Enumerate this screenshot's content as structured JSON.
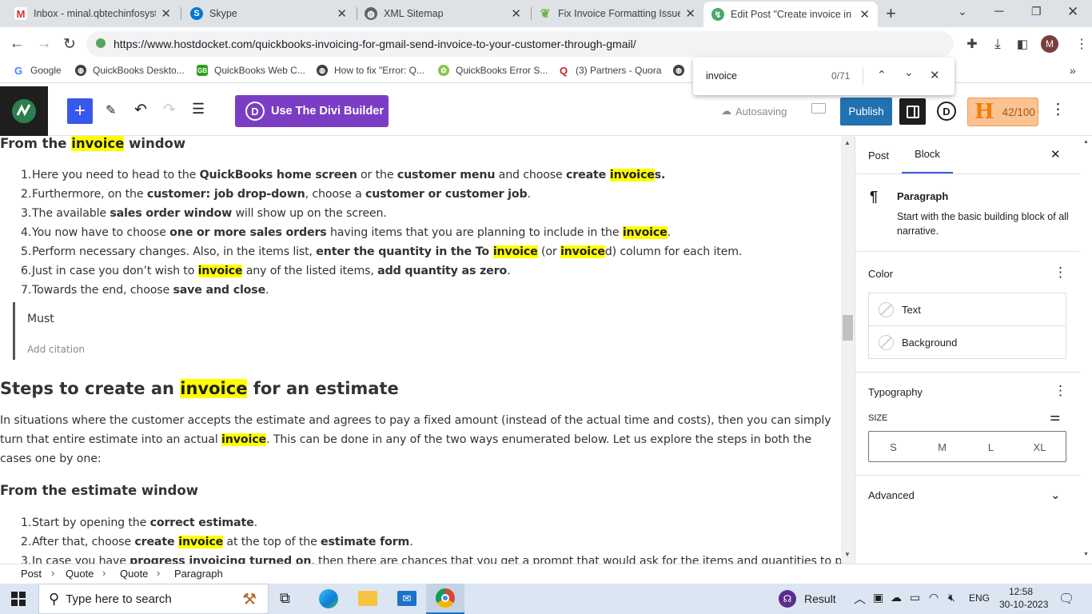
{
  "browser": {
    "tabs": [
      {
        "title": "Inbox - minal.qbtechinfosyst",
        "icon": "gmail-icon"
      },
      {
        "title": "Skype",
        "icon": "skype-icon"
      },
      {
        "title": "XML Sitemap",
        "icon": "globe-icon"
      },
      {
        "title": "Fix Invoice Formatting Issue",
        "icon": "leaf-icon"
      },
      {
        "title": "Edit Post \"Create invoice in Q",
        "icon": "wp-site-icon"
      }
    ],
    "url": "https://www.hostdocket.com/quickbooks-invoicing-for-gmail-send-invoice-to-your-customer-through-gmail/",
    "profile_initial": "M",
    "bookmarks": [
      "Google",
      "QuickBooks Deskto...",
      "QuickBooks Web C...",
      "How to fix \"Error: Q...",
      "QuickBooks Error S...",
      "(3) Partners - Quora"
    ],
    "find": {
      "query": "invoice",
      "count": "0/71"
    }
  },
  "wp_toolbar": {
    "divi_label": "Use The Divi Builder",
    "autosave": "Autosaving",
    "publish": "Publish",
    "divi_icon_letter": "D",
    "seo_letter": "H",
    "seo_score": "42/100"
  },
  "content": {
    "h_invoice_window": [
      "From the ",
      "invoice",
      " window"
    ],
    "list1": [
      [
        "Here you need to head to the ",
        "QuickBooks home screen",
        " or the ",
        "customer menu",
        " and choose ",
        "create ",
        "invoice",
        "s."
      ],
      [
        "Furthermore, on the ",
        "customer: job drop-down",
        ", choose a ",
        "customer or customer job",
        "."
      ],
      [
        "The available ",
        "sales order window",
        " will show up on the screen."
      ],
      [
        "You now have to choose ",
        "one or more sales orders",
        " having items that you are planning to include in the ",
        "invoice",
        "."
      ],
      [
        "Perform necessary changes. Also, in the items list, ",
        "enter the quantity in the To ",
        "invoice",
        " (or ",
        "invoice",
        "d) column for each item."
      ],
      [
        "Just in case you don’t wish to ",
        "invoice",
        " any of the listed items, ",
        "add quantity as zero",
        "."
      ],
      [
        "Towards the end, choose ",
        "save and close",
        "."
      ]
    ],
    "quote": {
      "text": "Must",
      "citation_placeholder": "Add citation"
    },
    "h_steps": [
      "Steps to create an ",
      "invoice",
      " for an estimate"
    ],
    "para": [
      "In situations where the customer accepts the estimate and agrees to pay a fixed amount (instead of the actual time and costs), then you can simply turn that entire estimate into an actual ",
      "invoice",
      ". This can be done in any of the two ways enumerated below. Let us explore the steps in both the cases one by one:"
    ],
    "h_estimate_window": "From the estimate window",
    "list2": [
      [
        "Start by opening the ",
        "correct estimate",
        "."
      ],
      [
        "After that, choose ",
        "create ",
        "invoice",
        " at the top of the ",
        "estimate form",
        "."
      ],
      [
        "In case you have ",
        "progress invoicing turned on",
        ", then there are chances that you get a prompt that would ask for the items and quantities to put"
      ]
    ]
  },
  "sidebar": {
    "tabs": [
      "Post",
      "Block"
    ],
    "block_title": "Paragraph",
    "block_desc": "Start with the basic building block of all narrative.",
    "color_title": "Color",
    "color_items": [
      "Text",
      "Background"
    ],
    "typography_title": "Typography",
    "size_label": "SIZE",
    "sizes": [
      "S",
      "M",
      "L",
      "XL"
    ],
    "advanced": "Advanced"
  },
  "breadcrumb": [
    "Post",
    "Quote",
    "Quote",
    "Paragraph"
  ],
  "taskbar": {
    "search_placeholder": "Type here to search",
    "result_label": "Result",
    "lang": "ENG",
    "time": "12:58",
    "date": "30-10-2023"
  },
  "colors": {
    "accent": "#3858e9",
    "divi": "#7b3dc4",
    "publish": "#2271b1",
    "highlight": "#ffff00",
    "tabbar": "#dee1e6",
    "taskbar": "#dce6f2"
  }
}
